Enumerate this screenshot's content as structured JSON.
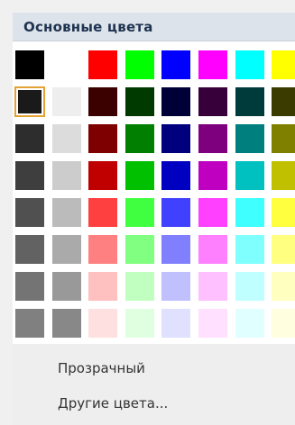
{
  "header": {
    "title": "Основные цвета"
  },
  "palette": {
    "selected": {
      "row": 1,
      "col": 0
    },
    "rows": [
      [
        "#000000",
        "#ffffff",
        "#ff0000",
        "#00ff00",
        "#0000ff",
        "#ff00ff",
        "#00ffff",
        "#ffff00"
      ],
      [
        "#1a1a1a",
        "#eeeeee",
        "#3b0000",
        "#003a00",
        "#000038",
        "#38003a",
        "#003b3b",
        "#3b3b00"
      ],
      [
        "#2d2d2d",
        "#dcdcdc",
        "#7f0000",
        "#007f00",
        "#00007f",
        "#7f007f",
        "#007f7f",
        "#7f7f00"
      ],
      [
        "#3e3e3e",
        "#cccccc",
        "#c00000",
        "#00c000",
        "#0000c0",
        "#c000c0",
        "#00c0c0",
        "#c0c000"
      ],
      [
        "#505050",
        "#bbbbbb",
        "#ff4040",
        "#40ff40",
        "#4040ff",
        "#ff40ff",
        "#40ffff",
        "#ffff40"
      ],
      [
        "#626262",
        "#aaaaaa",
        "#ff8080",
        "#80ff80",
        "#8080ff",
        "#ff80ff",
        "#80ffff",
        "#ffff80"
      ],
      [
        "#747474",
        "#999999",
        "#ffc0c0",
        "#c0ffc0",
        "#c0c0ff",
        "#ffc0ff",
        "#c0ffff",
        "#ffffc0"
      ],
      [
        "#808080",
        "#888888",
        "#ffe0e0",
        "#e0ffe0",
        "#e0e0ff",
        "#ffe0ff",
        "#e0ffff",
        "#ffffe0"
      ]
    ]
  },
  "menu": {
    "transparent_label": "Прозрачный",
    "more_colors_label": "Другие цвета..."
  }
}
